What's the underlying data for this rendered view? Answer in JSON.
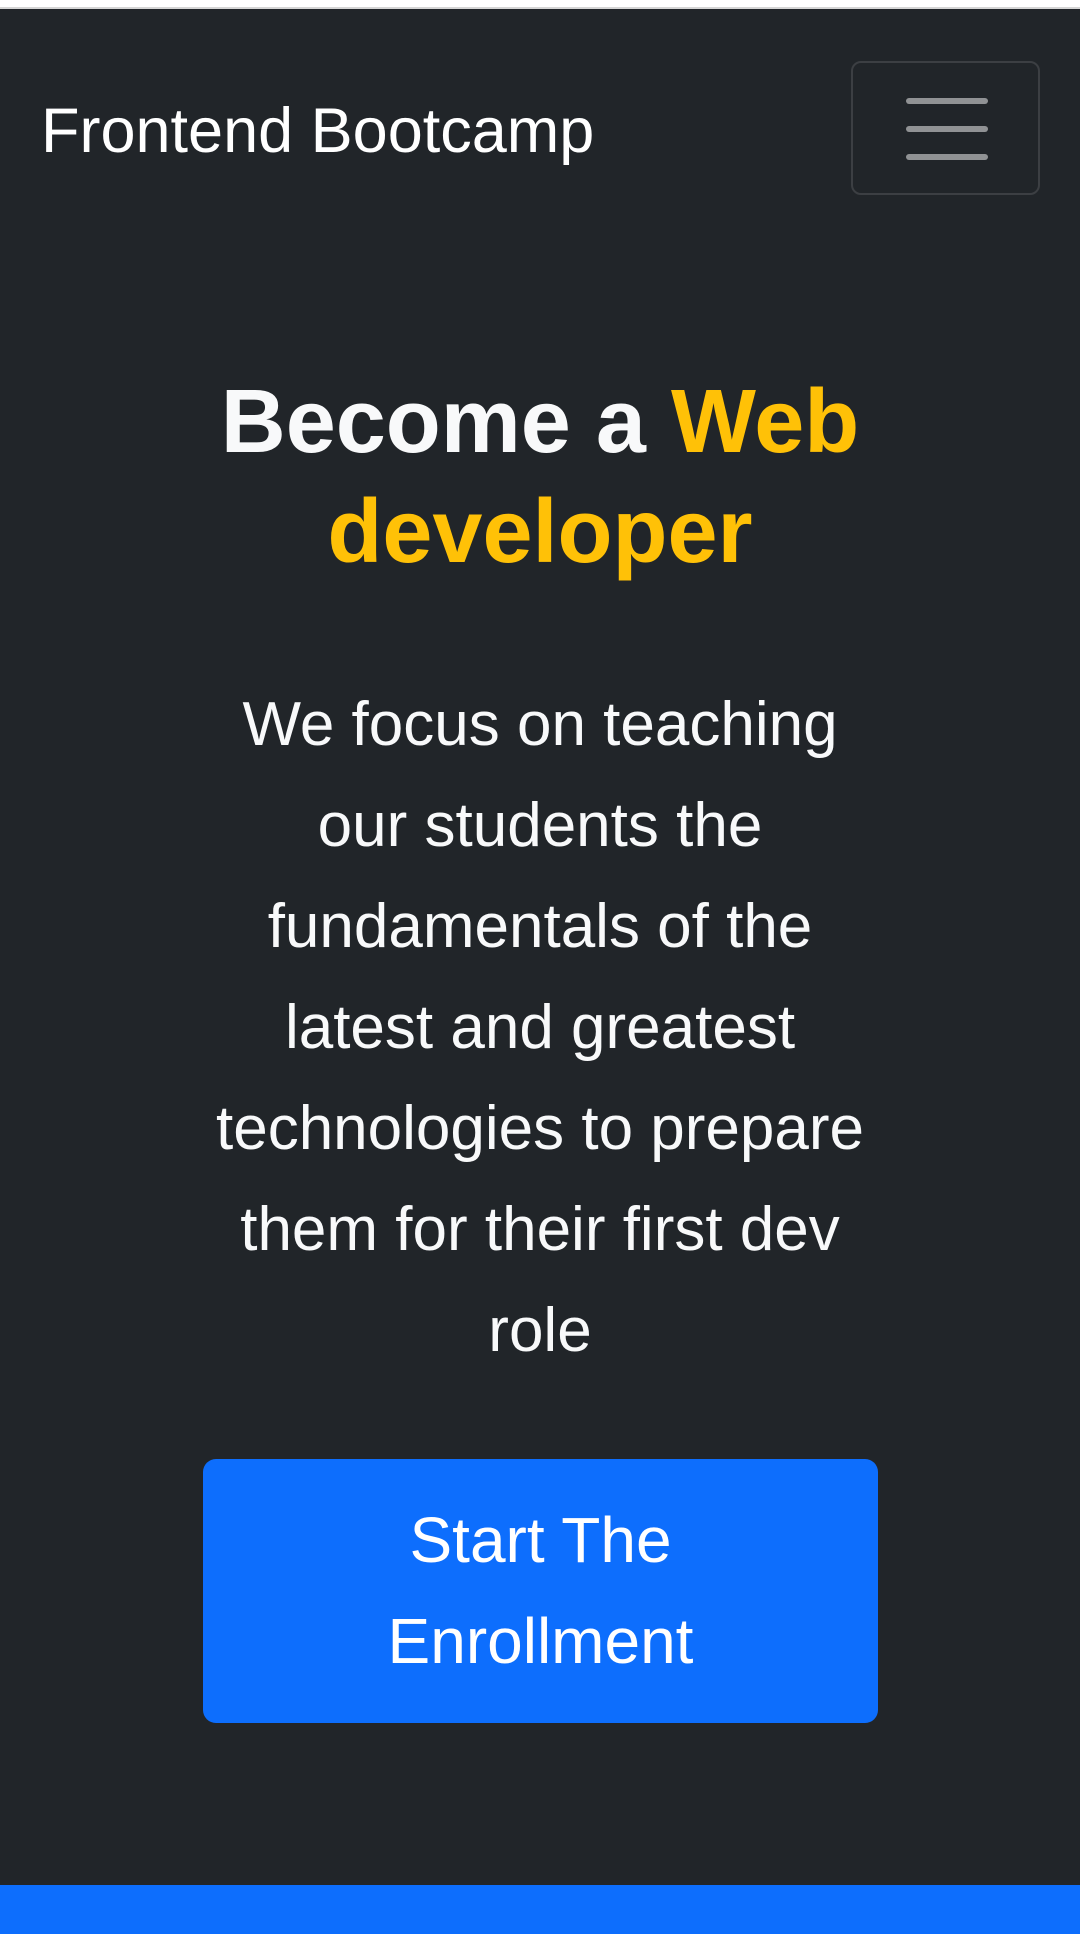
{
  "navbar": {
    "brand": "Frontend Bootcamp",
    "toggler_icon": "hamburger-menu-icon"
  },
  "hero": {
    "heading_prefix": "Become a ",
    "heading_highlight": "Web developer",
    "lead": "We focus on teaching our students the fundamentals of the latest and greatest technologies to prepare them for their first dev role",
    "cta_label": "Start The Enrollment"
  },
  "colors": {
    "background": "#212529",
    "accent": "#ffc107",
    "primary": "#0d6efd",
    "text": "#f8f9fa"
  }
}
